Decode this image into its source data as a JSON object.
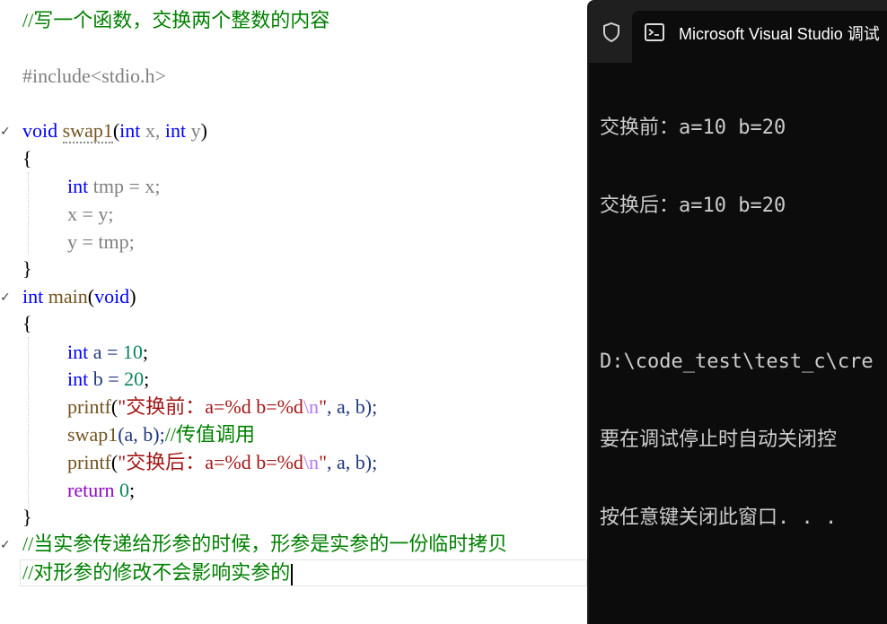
{
  "editor": {
    "lines": {
      "l1": "//写一个函数，交换两个整数的内容",
      "l3": "#include<stdio.h>",
      "l5_kw": "void",
      "l5_fn": "swap1",
      "l5_rest1": "(",
      "l5_int1": "int",
      "l5_x": " x, ",
      "l5_int2": "int",
      "l5_y": " y",
      "l5_close": ")",
      "l6": "{",
      "l7_kw": "int",
      "l7_rest": " tmp = x;",
      "l8": "x = y;",
      "l9": "y = tmp;",
      "l10": "}",
      "l11_kw": "int",
      "l11_fn": " main",
      "l11_open": "(",
      "l11_void": "void",
      "l11_close": ")",
      "l12": "{",
      "l13_kw": "int",
      "l13_var": " a = ",
      "l13_num": "10",
      "l13_end": ";",
      "l14_kw": "int",
      "l14_var": " b = ",
      "l14_num": "20",
      "l14_end": ";",
      "l15_fn": "printf",
      "l15_open": "(",
      "l15_str": "\"交换前：a=%d b=%d",
      "l15_esc": "\\n",
      "l15_q": "\"",
      "l15_rest": ", a, b);",
      "l16_fn": "swap1",
      "l16_rest": "(a, b);",
      "l16_comment": "//传值调用",
      "l17_fn": "printf",
      "l17_open": "(",
      "l17_str": "\"交换后：a=%d b=%d",
      "l17_esc": "\\n",
      "l17_q": "\"",
      "l17_rest": ", a, b);",
      "l18_kw": "return",
      "l18_num": " 0",
      "l18_end": ";",
      "l19": "}",
      "l20": "//当实参传递给形参的时候，形参是实参的一份临时拷贝",
      "l21": "//对形参的修改不会影响实参的"
    }
  },
  "terminal": {
    "tab_title": "Microsoft Visual Studio 调试",
    "output": [
      "交换前：a=10 b=20",
      "交换后：a=10 b=20",
      "",
      "D:\\code_test\\test_c\\cre",
      "要在调试停止时自动关闭控",
      "按任意键关闭此窗口. . ."
    ]
  },
  "icons": {
    "shield": "shield-icon",
    "terminal": "terminal-icon"
  }
}
